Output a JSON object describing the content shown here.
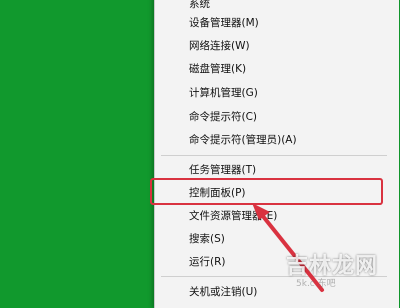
{
  "menu": {
    "items": [
      {
        "label": "系统"
      },
      {
        "label": "设备管理器(M)"
      },
      {
        "label": "网络连接(W)"
      },
      {
        "label": "磁盘管理(K)"
      },
      {
        "label": "计算机管理(G)"
      },
      {
        "label": "命令提示符(C)"
      },
      {
        "label": "命令提示符(管理员)(A)"
      },
      {
        "label": "任务管理器(T)"
      },
      {
        "label": "控制面板(P)"
      },
      {
        "label": "文件资源管理器(E)"
      },
      {
        "label": "搜索(S)"
      },
      {
        "label": "运行(R)"
      },
      {
        "label": "关机或注销(U)"
      }
    ]
  },
  "annotation": {
    "highlight_color": "#d93240",
    "arrow_color": "#d93240"
  },
  "watermark": {
    "text": "吉林龙网",
    "sub": "5k.c 东吧"
  },
  "colors": {
    "desktop": "#11992d",
    "menu_bg": "#f3f3f3"
  }
}
